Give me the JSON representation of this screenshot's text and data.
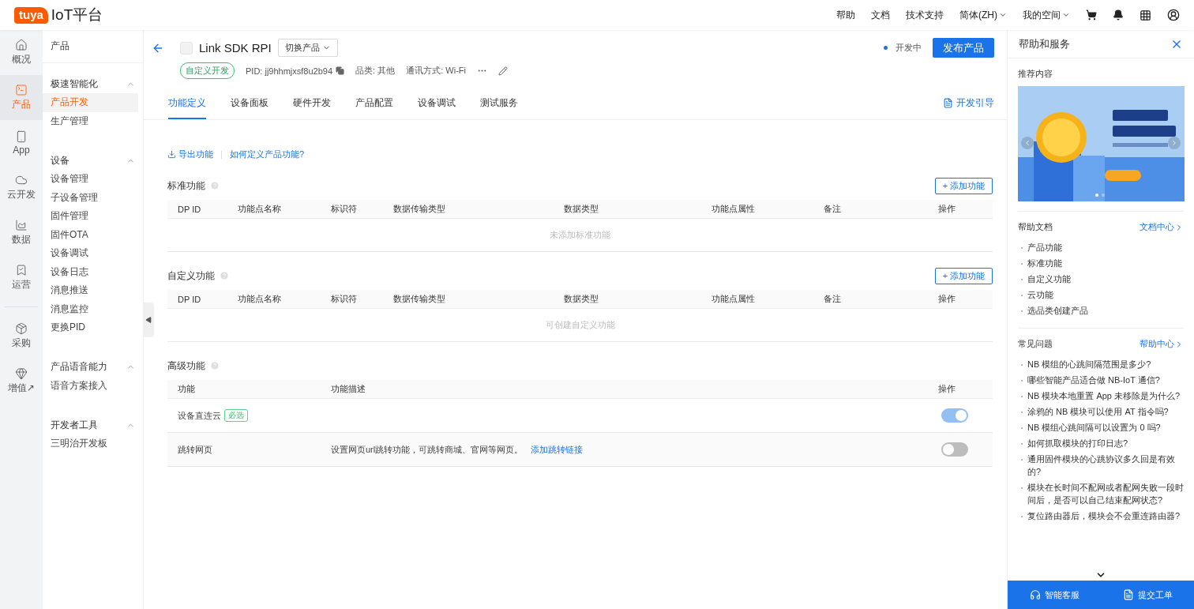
{
  "header": {
    "logo": "tuya",
    "title": "IoT平台",
    "nav": [
      {
        "label": "帮助",
        "kind": "link"
      },
      {
        "label": "文档",
        "kind": "link"
      },
      {
        "label": "技术支持",
        "kind": "link"
      },
      {
        "label": "简体(ZH)",
        "kind": "dropdown"
      },
      {
        "label": "我的空间",
        "kind": "dropdown"
      }
    ]
  },
  "rail": [
    {
      "label": "概况",
      "kind": "home",
      "selected": false
    },
    {
      "label": "产品",
      "kind": "terminal",
      "selected": true
    },
    {
      "label": "App",
      "kind": "phone",
      "selected": false
    },
    {
      "label": "云开发",
      "kind": "cloud",
      "selected": false
    },
    {
      "label": "数据",
      "kind": "chart",
      "selected": false
    },
    {
      "label": "运营",
      "kind": "star",
      "selected": false
    },
    {
      "label": "采购",
      "kind": "package",
      "selected": false
    },
    {
      "label": "增值↗",
      "kind": "gem",
      "selected": false
    }
  ],
  "submenu": {
    "title": "产品",
    "groups": [
      {
        "label": "极速智能化",
        "expanded": true,
        "items": [
          {
            "label": "产品开发",
            "selected": true
          },
          {
            "label": "生产管理",
            "selected": false
          }
        ]
      },
      {
        "label": "设备",
        "expanded": true,
        "items": [
          {
            "label": "设备管理",
            "selected": false
          },
          {
            "label": "子设备管理",
            "selected": false
          },
          {
            "label": "固件管理",
            "selected": false
          },
          {
            "label": "固件OTA",
            "selected": false
          },
          {
            "label": "设备调试",
            "selected": false
          },
          {
            "label": "设备日志",
            "selected": false
          },
          {
            "label": "消息推送",
            "selected": false
          },
          {
            "label": "消息监控",
            "selected": false
          },
          {
            "label": "更换PID",
            "selected": false
          }
        ]
      },
      {
        "label": "产品语音能力",
        "expanded": true,
        "items": [
          {
            "label": "语音方案接入",
            "selected": false
          }
        ]
      },
      {
        "label": "开发者工具",
        "expanded": true,
        "items": [
          {
            "label": "三明治开发板",
            "selected": false
          }
        ]
      }
    ]
  },
  "product": {
    "name": "Link SDK RPI",
    "switch_label": "切换产品",
    "tag": "自定义开发",
    "pid": "PID: jj9hhmjxsf8u2b94",
    "category": "品类: 其他",
    "protocol": "通讯方式: Wi-Fi",
    "status": "开发中",
    "publish_label": "发布产品"
  },
  "tabs": [
    {
      "label": "功能定义",
      "selected": true
    },
    {
      "label": "设备面板",
      "selected": false
    },
    {
      "label": "硬件开发",
      "selected": false
    },
    {
      "label": "产品配置",
      "selected": false
    },
    {
      "label": "设备调试",
      "selected": false
    },
    {
      "label": "测试服务",
      "selected": false
    }
  ],
  "guide_link": "开发引导",
  "actions": {
    "export": "导出功能",
    "howto": "如何定义产品功能?"
  },
  "sections": [
    {
      "title": "标准功能",
      "add_label": "+ 添加功能",
      "columns": [
        "DP ID",
        "功能点名称",
        "标识符",
        "数据传输类型",
        "数据类型",
        "功能点属性",
        "备注",
        "操作"
      ],
      "empty": "未添加标准功能"
    },
    {
      "title": "自定义功能",
      "add_label": "+ 添加功能",
      "columns": [
        "DP ID",
        "功能点名称",
        "标识符",
        "数据传输类型",
        "数据类型",
        "功能点属性",
        "备注",
        "操作"
      ],
      "empty": "可创建自定义功能"
    }
  ],
  "advanced": {
    "title": "高级功能",
    "columns": [
      "功能",
      "功能描述",
      "操作"
    ],
    "rows": [
      {
        "name": "设备直连云",
        "tag": "必选",
        "on": true,
        "disabled": true
      },
      {
        "name": "跳转网页",
        "description": "设置网页url跳转功能，可跳转商城、官网等网页。",
        "link": "添加跳转链接",
        "on": false,
        "disabled": false
      }
    ]
  },
  "help": {
    "title": "帮助和服务",
    "recommended": "推荐内容",
    "docs": {
      "title": "帮助文档",
      "more": "文档中心",
      "items": [
        "产品功能",
        "标准功能",
        "自定义功能",
        "云功能",
        "选品类创建产品"
      ]
    },
    "faq": {
      "title": "常见问题",
      "more": "帮助中心",
      "items": [
        "NB 模组的心跳间隔范围是多少?",
        "哪些智能产品适合做 NB-IoT 通信?",
        "NB 模块本地重置 App 未移除是为什么?",
        "涂鸦的 NB 模块可以使用 AT 指令吗?",
        "NB 模组心跳间隔可以设置为 0 吗?",
        "如何抓取模块的打印日志?",
        "通用固件模块的心跳协议多久回是有效的?",
        "模块在长时间不配网或者配网失败一段时间后，是否可以自己结束配网状态?",
        "复位路由器后，模块会不会重连路由器?"
      ]
    },
    "footer": [
      {
        "label": "智能客服",
        "kind": "chat"
      },
      {
        "label": "提交工单",
        "kind": "ticket"
      }
    ]
  }
}
